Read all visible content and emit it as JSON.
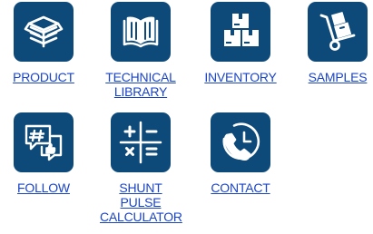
{
  "colors": {
    "tile_bg": "#0d4a7a",
    "link": "#1a44c8",
    "icon_fg": "#ffffff"
  },
  "tiles": [
    {
      "label": "PRODUCT",
      "icon": "box-icon"
    },
    {
      "label": "TECHNICAL LIBRARY",
      "icon": "book-icon"
    },
    {
      "label": "INVENTORY",
      "icon": "boxes-icon"
    },
    {
      "label": "SAMPLES",
      "icon": "hand-truck-icon"
    },
    {
      "label": "FOLLOW",
      "icon": "social-chat-icon"
    },
    {
      "label": "SHUNT PULSE CALCULATOR",
      "icon": "calculator-icon"
    },
    {
      "label": "CONTACT",
      "icon": "phone-icon"
    }
  ]
}
